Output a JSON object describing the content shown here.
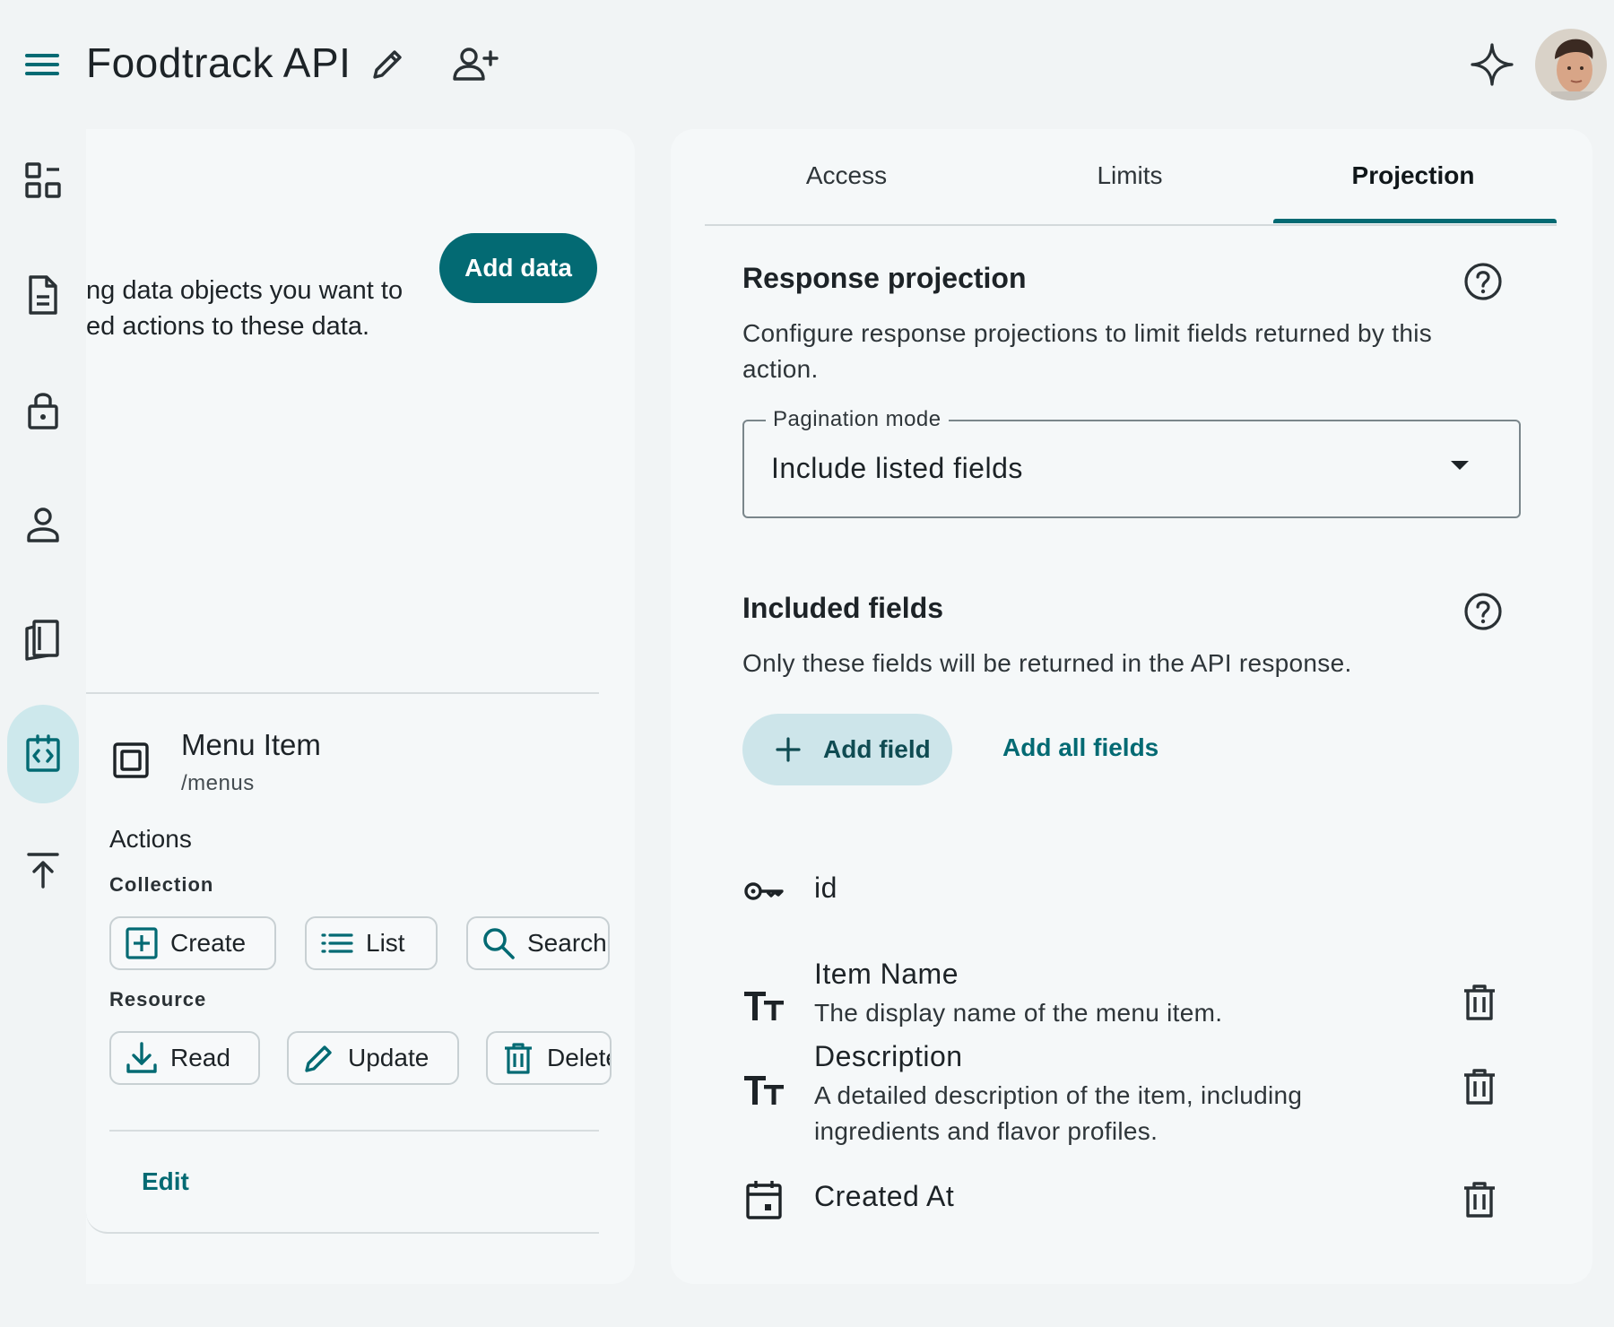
{
  "header": {
    "title": "Foodtrack API"
  },
  "rail": {
    "items": [
      "overview-icon",
      "document-icon",
      "lock-icon",
      "person-icon",
      "book-icon",
      "api-icon",
      "upload-icon"
    ],
    "active": "api-icon"
  },
  "intro": {
    "text": "ng data objects you want to\ned actions to these data.",
    "add_data_label": "Add data"
  },
  "entity": {
    "name": "Menu Item",
    "path": "/menus",
    "actions_title": "Actions",
    "collection_title": "Collection",
    "resource_title": "Resource",
    "collection_actions": [
      "Create",
      "List",
      "Search"
    ],
    "resource_actions": [
      "Read",
      "Update",
      "Delete"
    ],
    "edit_label": "Edit"
  },
  "tabs": {
    "items": [
      "Access",
      "Limits",
      "Projection"
    ],
    "active": "Projection"
  },
  "projection": {
    "title": "Response projection",
    "description": "Configure response projections to limit fields returned by this action.",
    "pagination_label": "Pagination mode",
    "pagination_value": "Include listed fields"
  },
  "included": {
    "title": "Included fields",
    "description": "Only these fields will be returned in the API response.",
    "add_field_label": "Add field",
    "add_all_label": "Add all fields",
    "fields": [
      {
        "name": "id",
        "description": "",
        "icon": "key-icon"
      },
      {
        "name": "Item Name",
        "description": "The display name of the menu item.",
        "icon": "text-type-icon"
      },
      {
        "name": "Description",
        "description": "A detailed description of the item, including ingredients and flavor profiles.",
        "icon": "text-type-icon"
      },
      {
        "name": "Created At",
        "description": "",
        "icon": "calendar-icon"
      }
    ]
  },
  "colors": {
    "primary": "#036a73",
    "primary_container": "#cde5ea",
    "background": "#f1f4f5",
    "surface": "#f5f8f9"
  }
}
